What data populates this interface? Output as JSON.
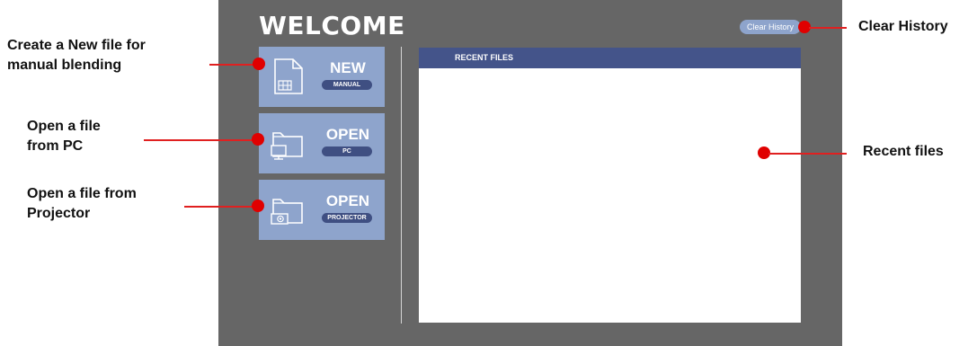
{
  "app": {
    "welcome_title": "WELCOME",
    "clear_history_button": "Clear History"
  },
  "tiles": [
    {
      "title": "NEW",
      "subtitle": "MANUAL",
      "icon": "new-file-icon"
    },
    {
      "title": "OPEN",
      "subtitle": "PC",
      "icon": "open-pc-icon"
    },
    {
      "title": "OPEN",
      "subtitle": "PROJECTOR",
      "icon": "open-projector-icon"
    }
  ],
  "recent_files": {
    "header": "RECENT FILES",
    "items": []
  },
  "annotations": {
    "new_file_line1": "Create a New file for",
    "new_file_line2": "manual blending",
    "open_pc_line1": "Open a file",
    "open_pc_line2": "from PC",
    "open_projector_line1": "Open a file from",
    "open_projector_line2": "Projector",
    "clear_history": "Clear History",
    "recent_files": "Recent files"
  },
  "colors": {
    "panel": "#666666",
    "tile": "#8ea4cc",
    "header": "#44548a",
    "pill": "#3f4f82",
    "callout_marker": "#e00000"
  }
}
